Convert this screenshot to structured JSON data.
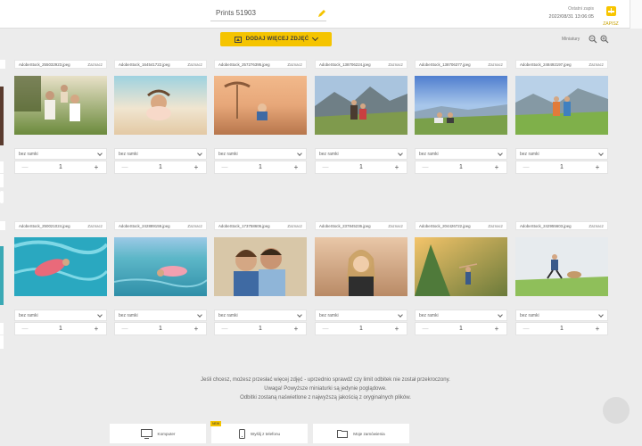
{
  "header": {
    "title": "Prints 51903",
    "last_save_label": "Ostatni zapis",
    "last_save_date": "2022/08/31 13:06:05",
    "save_label": "ZAPISZ"
  },
  "toolbar": {
    "add_photos_label": "DODAJ WIĘCEJ ZDJĘĆ",
    "thumbnails_label": "Miniatury"
  },
  "select_label": "Zaznacz",
  "photos": [
    {
      "file": "AdobeStock_255032923.jpeg",
      "frame": "bez ramki",
      "qty": "1"
    },
    {
      "file": "AdobeStock_164541722.jpeg",
      "frame": "bez ramki",
      "qty": "1"
    },
    {
      "file": "AdobeStock_257276395.jpeg",
      "frame": "bez ramki",
      "qty": "1"
    },
    {
      "file": "AdobeStock_138706224.jpeg",
      "frame": "bez ramki",
      "qty": "1"
    },
    {
      "file": "AdobeStock_138706377.jpeg",
      "frame": "bez ramki",
      "qty": "1"
    },
    {
      "file": "AdobeStock_248492197.jpeg",
      "frame": "bez ramki",
      "qty": "1"
    },
    {
      "file": "AdobeStock_250021024.jpeg",
      "frame": "bez ramki",
      "qty": "1"
    },
    {
      "file": "AdobeStock_242889159.jpeg",
      "frame": "bez ramki",
      "qty": "1"
    },
    {
      "file": "AdobeStock_173758606.jpeg",
      "frame": "bez ramki",
      "qty": "1"
    },
    {
      "file": "AdobeStock_237845236.jpeg",
      "frame": "bez ramki",
      "qty": "1"
    },
    {
      "file": "AdobeStock_204426722.jpeg",
      "frame": "bez ramki",
      "qty": "1"
    },
    {
      "file": "AdobeStock_242955603.jpeg",
      "frame": "bez ramki",
      "qty": "1"
    }
  ],
  "partial_left": {
    "frame": "bez ramki"
  },
  "info": {
    "line1": "Jeśli chcesz, możesz przesłać więcej zdjęć - uprzednio sprawdź czy limit odbitek nie został przekroczony.",
    "line2": "Uwaga! Powyższe miniaturki są jedynie poglądowe.",
    "line3": "Odbitki zostaną naświetlone z najwyższą jakością z oryginalnych plików."
  },
  "bottom": {
    "computer_label": "Komputer",
    "phone_label": "Wyślij z telefonu",
    "phone_badge": "NEW",
    "orders_label": "Moje zamówienia"
  },
  "icons": [
    "pencil-icon",
    "save-icon",
    "image-icon",
    "chevron-down-icon",
    "zoom-out-icon",
    "zoom-in-icon",
    "monitor-icon",
    "phone-icon",
    "folder-icon"
  ],
  "colors": {
    "accent": "#f5c400",
    "background": "#ececec"
  }
}
